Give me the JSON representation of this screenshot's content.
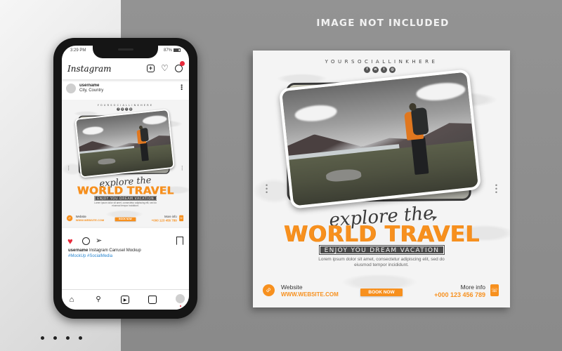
{
  "header": {
    "banner_text": "IMAGE NOT INCLUDED"
  },
  "phone": {
    "status_time": "3:29 PM",
    "status_battery": "87%",
    "app_name": "Instagram",
    "post_username": "username",
    "post_location": "City, Country",
    "caption_username": "username",
    "caption_text": "Instagram Carrusel Mockup",
    "hashtags": "#MockUp #SocialMedia",
    "icons": {
      "new_post": "plus-square-icon",
      "activity": "heart-icon",
      "messages": "messenger-icon",
      "like": "heart-filled-icon",
      "comment": "comment-icon",
      "share": "send-icon",
      "save": "bookmark-icon",
      "nav": [
        "home-icon",
        "search-icon",
        "reels-icon",
        "shop-icon",
        "profile-avatar"
      ]
    },
    "colors": {
      "like": "#e82a3b",
      "hashtag": "#2a86d0"
    }
  },
  "post": {
    "social_link": "YOURSOCIALLINKHERE",
    "social_icons": [
      "facebook-icon",
      "whatsapp-icon",
      "twitter-icon",
      "instagram-icon"
    ],
    "script_title": "explore the",
    "main_title": "WORLD TRAVEL",
    "subtitle": "ENJOY YOU DREAM VACATION",
    "body": "Lorem ipsum dolor sit amet, consectetur adipiscing elit, sed do eiusmod tempor incididunt.",
    "website_label": "Website",
    "website_value": "WWW.WEBSITE.COM",
    "book_button": "BOOK NOW",
    "more_info_label": "More info",
    "phone_value": "+000 123 456 789",
    "colors": {
      "accent": "#f7901e",
      "dark": "#4a4a4a"
    }
  },
  "pager": {
    "dots": 4
  }
}
